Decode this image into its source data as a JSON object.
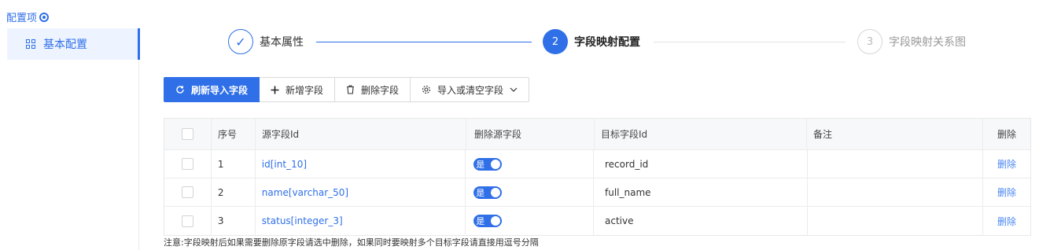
{
  "sidebar": {
    "title": "配置项",
    "items": [
      {
        "label": "基本配置"
      }
    ]
  },
  "steps": [
    {
      "number": "✓",
      "label": "基本属性",
      "state": "done"
    },
    {
      "number": "2",
      "label": "字段映射配置",
      "state": "active"
    },
    {
      "number": "3",
      "label": "字段映射关系图",
      "state": "pending"
    }
  ],
  "toolbar": {
    "refresh_label": "刷新导入字段",
    "add_label": "新增字段",
    "delete_label": "删除字段",
    "import_label": "导入或清空字段"
  },
  "table": {
    "headers": {
      "index": "序号",
      "source": "源字段Id",
      "delete_source": "删除源字段",
      "target": "目标字段Id",
      "note": "备注",
      "action": "删除"
    },
    "rows": [
      {
        "index": "1",
        "source": "id[int_10]",
        "toggle": "是",
        "target": "record_id",
        "note": "",
        "action": "删除"
      },
      {
        "index": "2",
        "source": "name[varchar_50]",
        "toggle": "是",
        "target": "full_name",
        "note": "",
        "action": "删除"
      },
      {
        "index": "3",
        "source": "status[integer_3]",
        "toggle": "是",
        "target": "active",
        "note": "",
        "action": "删除"
      }
    ]
  },
  "footer_note": "注意:字段映射后如果需要删除原字段请选中删除，如果同时要映射多个目标字段请直接用逗号分隔",
  "colors": {
    "accent": "#2f6fe8",
    "sidebar_bg": "#eef4ff"
  }
}
